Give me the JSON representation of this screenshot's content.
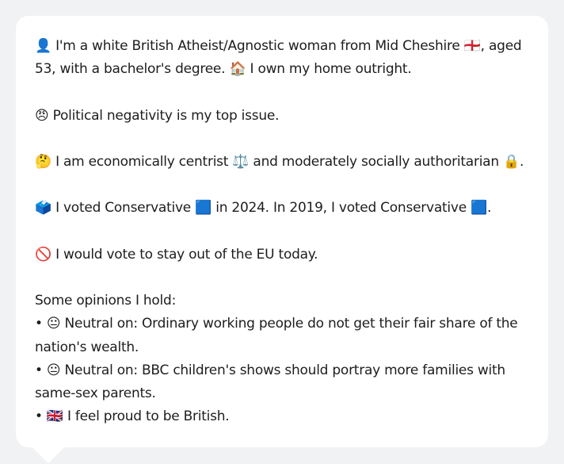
{
  "message": {
    "text": "👤 I'm a white British Atheist/Agnostic woman from Mid Cheshire 🏴󠁧󠁢󠁥󠁮󠁧󠁿, aged 53, with a bachelor's degree. 🏠 I own my home outright.\n\n😠 Political negativity is my top issue.\n\n🤔 I am economically centrist ⚖️ and moderately socially authoritarian 🔒.\n\n🗳️ I voted Conservative 🟦 in 2024. In 2019, I voted Conservative 🟦.\n\n🚫 I would vote to stay out of the EU today.\n\nSome opinions I hold:\n• 😐 Neutral on: Ordinary working people do not get their fair share of the nation's wealth.\n• 😐 Neutral on: BBC children's shows should portray more families with same-sex parents.\n• 🇬🇧 I feel proud to be British."
  }
}
